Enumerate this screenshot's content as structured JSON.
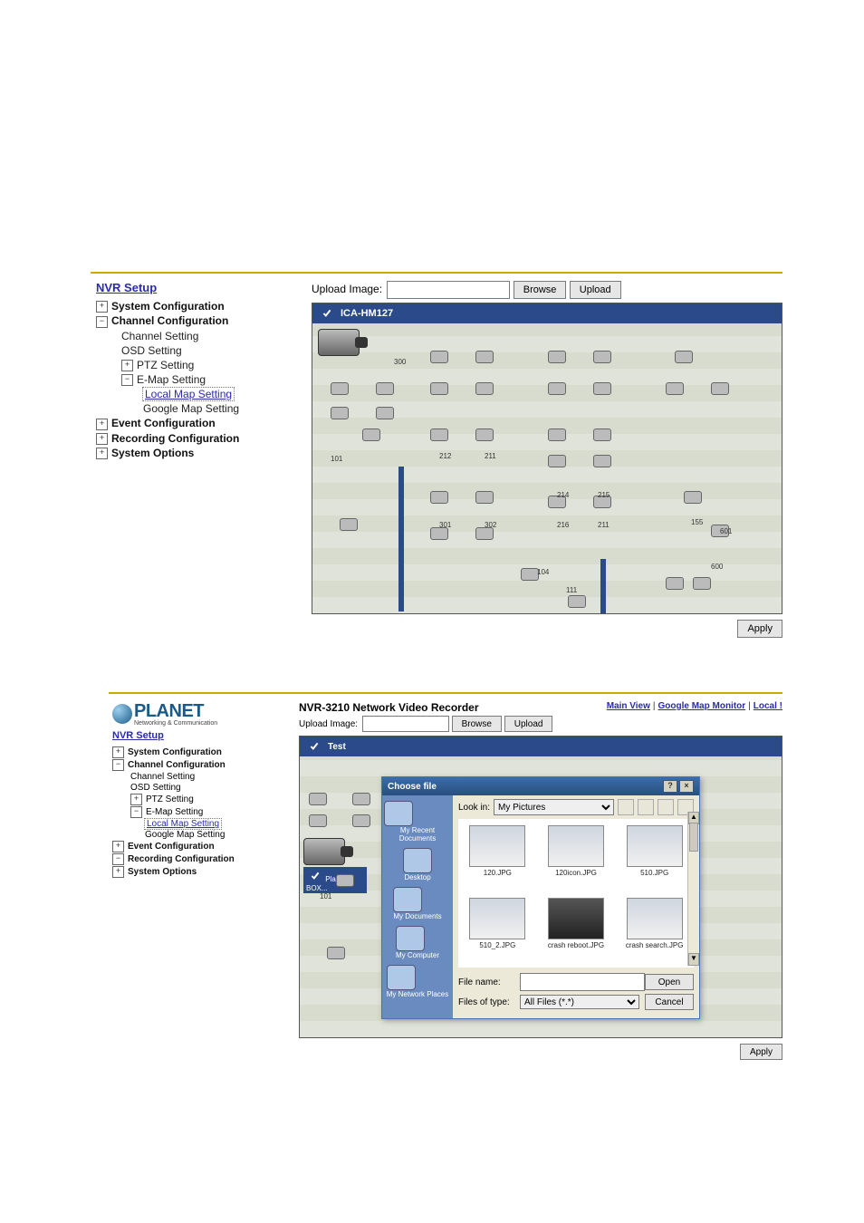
{
  "block1": {
    "nvr_title": "NVR Setup",
    "tree": {
      "sys_conf": "System Configuration",
      "chan_conf": "Channel Configuration",
      "chan_setting": "Channel Setting",
      "osd_setting": "OSD Setting",
      "ptz_setting": "PTZ Setting",
      "emap_setting": "E-Map Setting",
      "local_map": "Local Map Setting",
      "google_map": "Google Map Setting",
      "event_conf": "Event Configuration",
      "rec_conf": "Recording Configuration",
      "sys_opts": "System Options"
    },
    "upload_label": "Upload Image:",
    "browse_btn": "Browse",
    "upload_btn": "Upload",
    "camera_name": "ICA-HM127",
    "rooms": [
      "101",
      "212",
      "211",
      "214",
      "215",
      "301",
      "302",
      "216",
      "211",
      "111",
      "104",
      "155",
      "601",
      "600",
      "300"
    ],
    "apply_btn": "Apply"
  },
  "block2": {
    "brand": "PLANET",
    "brand_sub": "Networking & Communication",
    "product": "NVR-3210 Network Video Recorder",
    "toplinks": {
      "main": "Main View",
      "gmap": "Google Map Monitor",
      "local": "Local !"
    },
    "nvr_title": "NVR Setup",
    "tree": {
      "sys_conf": "System Configuration",
      "chan_conf": "Channel Configuration",
      "chan_setting": "Channel Setting",
      "osd_setting": "OSD Setting",
      "ptz_setting": "PTZ Setting",
      "emap_setting": "E-Map Setting",
      "local_map": "Local Map Setting",
      "google_map": "Google Map Setting",
      "event_conf": "Event Configuration",
      "rec_conf": "Recording Configuration",
      "sys_opts": "System Options"
    },
    "upload_label": "Upload Image:",
    "browse_btn": "Browse",
    "upload_btn": "Upload",
    "camera_name": "Test",
    "draggable_cam": "Planet BOX...",
    "apply_btn": "Apply",
    "dialog": {
      "title": "Choose file",
      "lookin_label": "Look in:",
      "lookin_value": "My Pictures",
      "places": [
        "My Recent Documents",
        "Desktop",
        "My Documents",
        "My Computer",
        "My Network Places"
      ],
      "thumbs": [
        "120.JPG",
        "120icon.JPG",
        "510.JPG",
        "510_2.JPG",
        "crash reboot.JPG",
        "crash search.JPG"
      ],
      "filename_label": "File name:",
      "filename_value": "",
      "filetype_label": "Files of type:",
      "filetype_value": "All Files (*.*)",
      "open_btn": "Open",
      "cancel_btn": "Cancel"
    }
  }
}
